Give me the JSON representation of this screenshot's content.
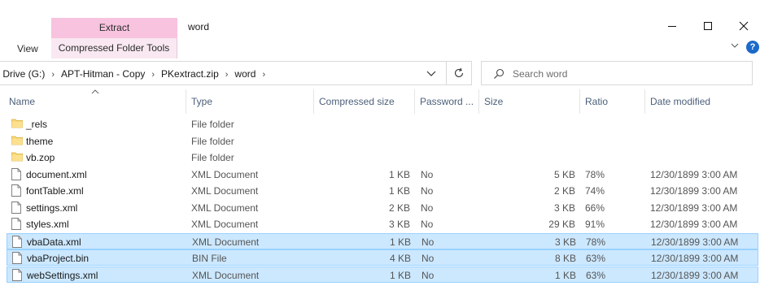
{
  "ribbon": {
    "context_header": "Extract",
    "context_tab": "Compressed Folder Tools",
    "view_tab": "View"
  },
  "window": {
    "title": "word",
    "minimize_icon": "minimize-icon",
    "maximize_icon": "maximize-icon",
    "close_icon": "close-icon",
    "help_icon": "help-icon",
    "help_glyph": "?"
  },
  "address": {
    "crumbs": [
      "ʽ Drive (G:)",
      "APT-Hitman - Copy",
      "PKextract.zip",
      "word"
    ],
    "drive_crumb": "Drive (G:)",
    "crumb2": "APT-Hitman - Copy",
    "crumb3": "PKextract.zip",
    "crumb4": "word"
  },
  "search": {
    "placeholder": "Search word"
  },
  "columns": {
    "name": "Name",
    "type": "Type",
    "compressed": "Compressed size",
    "password": "Password ...",
    "size": "Size",
    "ratio": "Ratio",
    "date": "Date modified"
  },
  "files": [
    {
      "name": "_rels",
      "type": "File folder",
      "compressed": "",
      "password": "",
      "size": "",
      "ratio": "",
      "date": "",
      "icon": "folder-icon",
      "selected": false
    },
    {
      "name": "theme",
      "type": "File folder",
      "compressed": "",
      "password": "",
      "size": "",
      "ratio": "",
      "date": "",
      "icon": "folder-icon",
      "selected": false
    },
    {
      "name": "vb.zop",
      "type": "File folder",
      "compressed": "",
      "password": "",
      "size": "",
      "ratio": "",
      "date": "",
      "icon": "folder-icon",
      "selected": false
    },
    {
      "name": "document.xml",
      "type": "XML Document",
      "compressed": "1 KB",
      "password": "No",
      "size": "5 KB",
      "ratio": "78%",
      "date": "12/30/1899 3:00 AM",
      "icon": "file-icon",
      "selected": false
    },
    {
      "name": "fontTable.xml",
      "type": "XML Document",
      "compressed": "1 KB",
      "password": "No",
      "size": "2 KB",
      "ratio": "74%",
      "date": "12/30/1899 3:00 AM",
      "icon": "file-icon",
      "selected": false
    },
    {
      "name": "settings.xml",
      "type": "XML Document",
      "compressed": "2 KB",
      "password": "No",
      "size": "3 KB",
      "ratio": "66%",
      "date": "12/30/1899 3:00 AM",
      "icon": "file-icon",
      "selected": false
    },
    {
      "name": "styles.xml",
      "type": "XML Document",
      "compressed": "3 KB",
      "password": "No",
      "size": "29 KB",
      "ratio": "91%",
      "date": "12/30/1899 3:00 AM",
      "icon": "file-icon",
      "selected": false
    },
    {
      "name": "vbaData.xml",
      "type": "XML Document",
      "compressed": "1 KB",
      "password": "No",
      "size": "3 KB",
      "ratio": "78%",
      "date": "12/30/1899 3:00 AM",
      "icon": "file-icon",
      "selected": true
    },
    {
      "name": "vbaProject.bin",
      "type": "BIN File",
      "compressed": "4 KB",
      "password": "No",
      "size": "8 KB",
      "ratio": "63%",
      "date": "12/30/1899 3:00 AM",
      "icon": "file-icon",
      "selected": true
    },
    {
      "name": "webSettings.xml",
      "type": "XML Document",
      "compressed": "1 KB",
      "password": "No",
      "size": "1 KB",
      "ratio": "63%",
      "date": "12/30/1899 3:00 AM",
      "icon": "file-icon",
      "selected": true
    }
  ],
  "colors": {
    "context_header": "#f7c3df",
    "selection": "#cce8ff",
    "selection_border": "#99d1ff",
    "folder": "#f8d775",
    "header_text": "#4c607a"
  }
}
